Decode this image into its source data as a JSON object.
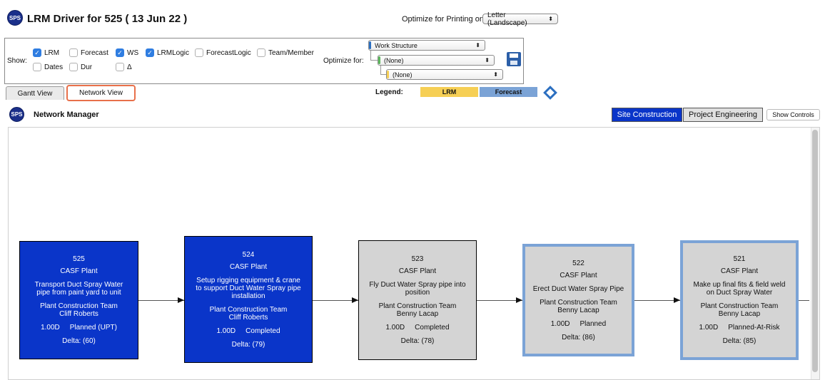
{
  "header": {
    "logo_text": "SPS",
    "title": "LRM Driver for 525 ( 13 Jun 22 )",
    "print_label": "Optimize for Printing on",
    "print_value": "Letter (Landscape)"
  },
  "controls": {
    "show_label": "Show:",
    "checkboxes": [
      {
        "label": "LRM",
        "checked": true
      },
      {
        "label": "Forecast",
        "checked": false
      },
      {
        "label": "WS",
        "checked": true
      },
      {
        "label": "LRMLogic",
        "checked": true
      },
      {
        "label": "ForecastLogic",
        "checked": false
      },
      {
        "label": "Team/Member",
        "checked": false
      },
      {
        "label": "Dates",
        "checked": false
      },
      {
        "label": "Dur",
        "checked": false
      },
      {
        "label": "Δ",
        "checked": false
      }
    ],
    "optimize_label": "Optimize for:",
    "optimize_selects": [
      "Work Structure",
      "(None)",
      "(None)"
    ]
  },
  "tabs": [
    "Gantt View",
    "Network View"
  ],
  "legend": {
    "label": "Legend:",
    "lrm": "LRM",
    "forecast": "Forecast",
    "colors": {
      "lrm": "#f6cf55",
      "forecast": "#7ba3d6"
    }
  },
  "network": {
    "title": "Network Manager",
    "filters": [
      "Site Construction",
      "Project Engineering"
    ],
    "show_controls": "Show Controls"
  },
  "nodes": [
    {
      "id": "525",
      "area": "CASF Plant",
      "desc": [
        "Transport Duct Spray Water",
        "pipe from paint yard to unit"
      ],
      "team": "Plant Construction Team",
      "member": "Cliff Roberts",
      "dur": "1.00D",
      "status": "Planned (UPT)",
      "delta": "Delta: (60)"
    },
    {
      "id": "524",
      "area": "CASF Plant",
      "desc": [
        "Setup rigging equipment & crane",
        "to support Duct Water Spray pipe",
        "installation"
      ],
      "team": "Plant Construction Team",
      "member": "Cliff Roberts",
      "dur": "1.00D",
      "status": "Completed",
      "delta": "Delta: (79)"
    },
    {
      "id": "523",
      "area": "CASF Plant",
      "desc": [
        "Fly Duct Water Spray pipe into",
        "position"
      ],
      "team": "Plant Construction Team",
      "member": "Benny Lacap",
      "dur": "1.00D",
      "status": "Completed",
      "delta": "Delta: (78)"
    },
    {
      "id": "522",
      "area": "CASF Plant",
      "desc": [
        "Erect Duct Water Spray Pipe"
      ],
      "team": "Plant Construction Team",
      "member": "Benny Lacap",
      "dur": "1.00D",
      "status": "Planned",
      "delta": "Delta: (86)"
    },
    {
      "id": "521",
      "area": "CASF Plant",
      "desc": [
        "Make up final fits & field weld",
        "on Duct Spray Water"
      ],
      "team": "Plant Construction Team",
      "member": "Benny Lacap",
      "dur": "1.00D",
      "status": "Planned-At-Risk",
      "delta": "Delta: (85)"
    }
  ]
}
